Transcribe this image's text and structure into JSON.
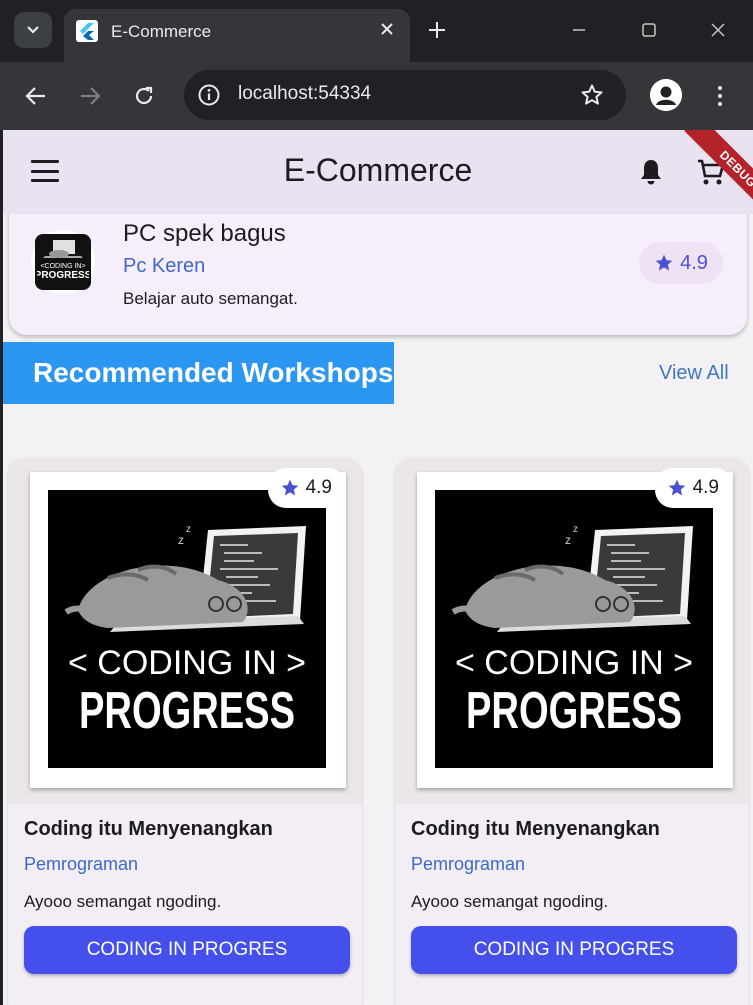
{
  "browser": {
    "tab_title": "E-Commerce",
    "url": "localhost:54334"
  },
  "appbar": {
    "title": "E-Commerce",
    "debug_label": "DEBUG"
  },
  "top_card": {
    "title": "PC spek bagus",
    "category": "Pc Keren",
    "description": "Belajar auto semangat.",
    "rating": "4.9",
    "thumb_text_line1": "< CODING IN >",
    "thumb_text_line2": "PROGRESS"
  },
  "section": {
    "title": "Recommended Workshops",
    "view_all": "View All"
  },
  "workshops": [
    {
      "rating": "4.9",
      "art_line1": "< CODING IN >",
      "art_line2": "PROGRESS",
      "title": "Coding itu Menyenangkan",
      "category": "Pemrograman",
      "description": "Ayooo semangat ngoding.",
      "button": "CODING IN PROGRES"
    },
    {
      "rating": "4.9",
      "art_line1": "< CODING IN >",
      "art_line2": "PROGRESS",
      "title": "Coding itu Menyenangkan",
      "category": "Pemrograman",
      "description": "Ayooo semangat ngoding.",
      "button": "CODING IN PROGRES"
    }
  ],
  "colors": {
    "appbar_bg": "#ebe2f1",
    "banner_blue": "#2b97f3",
    "button_indigo": "#4550ec",
    "star": "#4b52d2",
    "link_blue": "#3f69c6",
    "debug_red": "#b4232a"
  }
}
